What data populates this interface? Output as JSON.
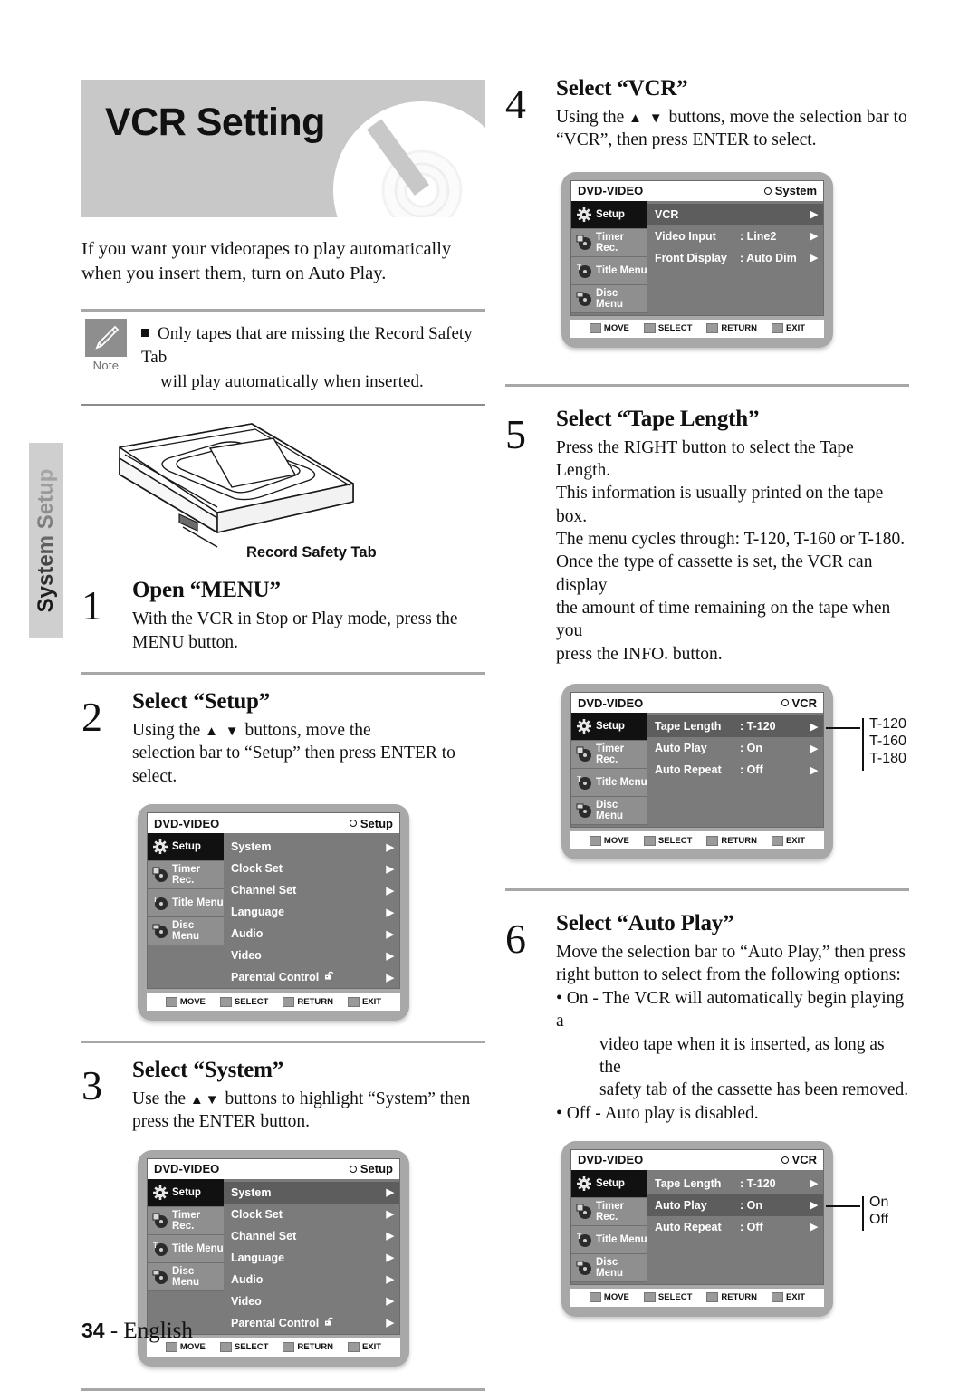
{
  "side_tab": {
    "label": "System Setup"
  },
  "header": {
    "title": "VCR Setting",
    "disc_icon": "dvd-disc-graphic"
  },
  "intro": "If you want your videotapes to play automatically when you insert them, turn on Auto Play.",
  "note": {
    "badge_label": "Note",
    "icon": "pencil-icon",
    "line1": "Only tapes that are missing the Record Safety  Tab",
    "line2": "will play automatically when inserted."
  },
  "tape_illustration": {
    "caption": "Record Safety Tab",
    "icon": "vhs-cassette-illustration"
  },
  "osd_common": {
    "brand": "DVD-VIDEO",
    "sidebar": [
      {
        "label": "Setup",
        "icon": "gear-icon"
      },
      {
        "label": "Timer Rec.",
        "icon": "timer-disc-icon"
      },
      {
        "label": "Title Menu",
        "icon": "title-disc-icon"
      },
      {
        "label": "Disc Menu",
        "icon": "disc-menu-icon"
      }
    ],
    "footer": [
      {
        "label": "MOVE",
        "icon": "updown-key-icon"
      },
      {
        "label": "SELECT",
        "icon": "enter-key-icon"
      },
      {
        "label": "RETURN",
        "icon": "return-key-icon"
      },
      {
        "label": "EXIT",
        "icon": "exit-key-icon"
      }
    ]
  },
  "steps": [
    {
      "number": "1",
      "title": "Open “MENU”",
      "text_lines": [
        "With the VCR in Stop or Play mode, press the",
        "MENU button."
      ]
    },
    {
      "number": "2",
      "title": "Select “Setup”",
      "text_pre": "Using the ",
      "arrows": "▲ ▼",
      "text_post": " buttons, move the",
      "text_line2": "selection bar to “Setup” then press ENTER to select."
    },
    {
      "number": "3",
      "title": "Select “System”",
      "text_pre": "Use the ",
      "arrows": "▲▼",
      "text_post": " buttons to highlight “System” then",
      "text_line2": "press the ENTER button."
    },
    {
      "number": "4",
      "title": "Select “VCR”",
      "text_pre": "Using the ",
      "arrows": "▲ ▼",
      "text_post": " buttons, move the selection bar to",
      "text_line2": "“VCR”, then press ENTER to select."
    },
    {
      "number": "5",
      "title": "Select “Tape Length”",
      "text_lines": [
        "Press the RIGHT button to select the Tape Length.",
        "This information is usually printed on the tape box.",
        "The menu cycles through: T-120, T-160 or T-180.",
        "Once the type of cassette is set, the VCR can display",
        "the amount of time remaining on the tape when you",
        "press the INFO. button."
      ]
    },
    {
      "number": "6",
      "title": "Select “Auto Play”",
      "text_lines": [
        "Move the selection bar to “Auto Play,” then press",
        "right button to select from the following options:"
      ],
      "bullets": [
        {
          "line1": "• On - The VCR will automatically begin playing a",
          "line2": "video tape when it is inserted, as long as the",
          "line3": "safety tab of the cassette has been removed."
        },
        {
          "line1": "• Off - Auto play is disabled."
        }
      ]
    }
  ],
  "osd_screens": [
    {
      "id": "setup-menu-step2",
      "title_right": "Setup",
      "selected_sidebar": 0,
      "rows": [
        {
          "label": "System",
          "value": "",
          "caret": "▶",
          "highlight": false
        },
        {
          "label": "Clock Set",
          "value": "",
          "caret": "▶",
          "highlight": false
        },
        {
          "label": "Channel Set",
          "value": "",
          "caret": "▶",
          "highlight": false
        },
        {
          "label": "Language",
          "value": "",
          "caret": "▶",
          "highlight": false
        },
        {
          "label": "Audio",
          "value": "",
          "caret": "▶",
          "highlight": false
        },
        {
          "label": "Video",
          "value": "",
          "caret": "▶",
          "highlight": false
        },
        {
          "label": "Parental Control",
          "value": "",
          "caret": "▶",
          "highlight": false,
          "lock": true
        }
      ]
    },
    {
      "id": "setup-menu-step3",
      "title_right": "Setup",
      "selected_sidebar": 0,
      "rows": [
        {
          "label": "System",
          "value": "",
          "caret": "▶",
          "highlight": true
        },
        {
          "label": "Clock Set",
          "value": "",
          "caret": "▶",
          "highlight": false
        },
        {
          "label": "Channel Set",
          "value": "",
          "caret": "▶",
          "highlight": false
        },
        {
          "label": "Language",
          "value": "",
          "caret": "▶",
          "highlight": false
        },
        {
          "label": "Audio",
          "value": "",
          "caret": "▶",
          "highlight": false
        },
        {
          "label": "Video",
          "value": "",
          "caret": "▶",
          "highlight": false
        },
        {
          "label": "Parental Control",
          "value": "",
          "caret": "▶",
          "highlight": false,
          "lock": true
        }
      ]
    },
    {
      "id": "system-menu-step4",
      "title_right": "System",
      "selected_sidebar": 0,
      "rows": [
        {
          "label": "VCR",
          "value": "",
          "caret": "▶",
          "highlight": true
        },
        {
          "label": "Video Input",
          "value": ": Line2",
          "caret": "▶",
          "highlight": false
        },
        {
          "label": "Front Display",
          "value": ": Auto Dim",
          "caret": "▶",
          "highlight": false
        }
      ]
    },
    {
      "id": "vcr-menu-step5",
      "title_right": "VCR",
      "selected_sidebar": 0,
      "rows": [
        {
          "label": "Tape Length",
          "value": ": T-120",
          "caret": "▶",
          "highlight": true
        },
        {
          "label": "Auto Play",
          "value": ": On",
          "caret": "▶",
          "highlight": false
        },
        {
          "label": "Auto Repeat",
          "value": ": Off",
          "caret": "▶",
          "highlight": false
        }
      ],
      "callout": {
        "options": [
          "T-120",
          "T-160",
          "T-180"
        ]
      }
    },
    {
      "id": "vcr-menu-step6",
      "title_right": "VCR",
      "selected_sidebar": 0,
      "rows": [
        {
          "label": "Tape Length",
          "value": ": T-120",
          "caret": "▶",
          "highlight": false
        },
        {
          "label": "Auto Play",
          "value": ": On",
          "caret": "▶",
          "highlight": true
        },
        {
          "label": "Auto Repeat",
          "value": ": Off",
          "caret": "▶",
          "highlight": false
        }
      ],
      "callout": {
        "options": [
          "On",
          "Off"
        ]
      }
    }
  ],
  "footer": {
    "page": "34",
    "sep": "-",
    "language": "English"
  }
}
